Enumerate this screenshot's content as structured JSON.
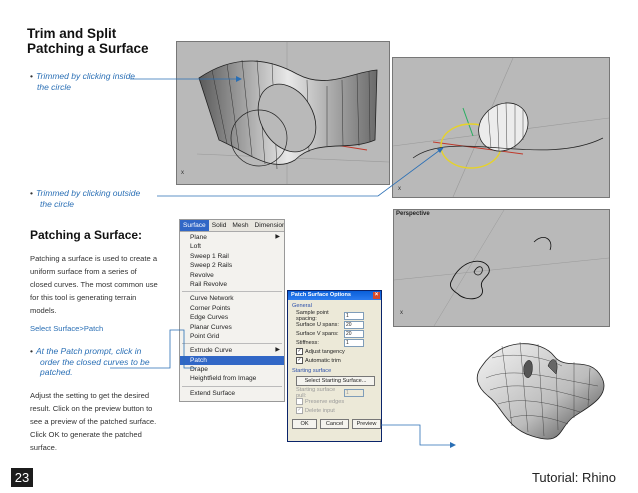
{
  "heading": {
    "line1": "Trim and Split",
    "line2": "Patching a Surface"
  },
  "bullets": {
    "inside_l1": "Trimmed by clicking inside",
    "inside_l2": "the circle",
    "outside_l1": "Trimmed by clicking outside",
    "outside_l2": "the circle"
  },
  "section": {
    "title": "Patching a Surface:",
    "para1": "Patching a surface is used to create a uniform surface from a series of closed curves. The most common use for this tool is generating terrain models.",
    "link": "Select Surface>Patch",
    "step_l1": "At the Patch prompt, click in",
    "step_l2": "order the closed curves to be",
    "step_l3": "patched.",
    "para2": "Adjust the setting to get the desired result. Click on the preview button to see a preview of the patched surface. Click OK to generate the patched surface."
  },
  "viewport": {
    "perspective_label": "Perspective"
  },
  "menu": {
    "bar": [
      "Surface",
      "Solid",
      "Mesh",
      "Dimension"
    ],
    "items": [
      "Plane",
      "Loft",
      "Sweep 1 Rail",
      "Sweep 2 Rails",
      "Revolve",
      "Rail Revolve",
      "Curve Network",
      "Corner Points",
      "Edge Curves",
      "Planar Curves",
      "Point Grid",
      "Extrude Curve",
      "Patch",
      "Drape",
      "Heightfield from Image",
      "Extend Surface"
    ]
  },
  "dialog": {
    "title": "Patch Surface Options",
    "general": "General",
    "sample_label": "Sample point spacing:",
    "sample_value": "1",
    "u_label": "Surface U spans:",
    "u_value": "20",
    "v_label": "Surface V spans:",
    "v_value": "20",
    "stiff_label": "Stiffness:",
    "stiff_value": "1",
    "adjust_label": "Adjust tangency",
    "trim_label": "Automatic trim",
    "starting": "Starting surface",
    "select_btn": "Select Starting Surface...",
    "pull_label": "Starting surface pull:",
    "pull_value": "1",
    "preserve_label": "Preserve edges",
    "delete_label": "Delete input",
    "ok": "OK",
    "cancel": "Cancel",
    "preview": "Preview"
  },
  "footer": {
    "page": "23",
    "title": "Tutorial: Rhino"
  }
}
